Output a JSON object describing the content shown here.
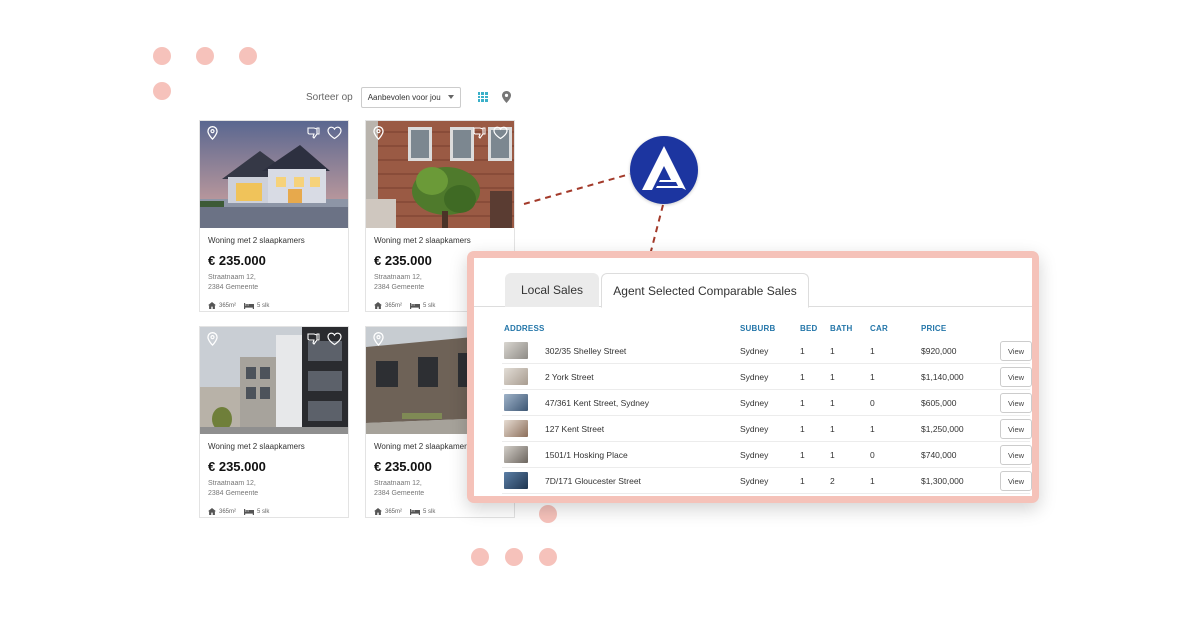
{
  "sort": {
    "label": "Sorteer op",
    "selected": "Aanbevolen voor jou"
  },
  "view_icons": [
    "grid-icon",
    "map-pin-icon"
  ],
  "listings": [
    {
      "title": "Woning met 2 slaapkamers",
      "price": "€ 235.000",
      "street": "Straatnaam 12,",
      "city": "2384 Gemeente",
      "area": "365m²",
      "beds": "5 slk"
    },
    {
      "title": "Woning met 2 slaapkamers",
      "price": "€ 235.000",
      "street": "Straatnaam 12,",
      "city": "2384 Gemeente",
      "area": "365m²",
      "beds": "5 slk"
    },
    {
      "title": "Woning met 2 slaapkamers",
      "price": "€ 235.000",
      "street": "Straatnaam 12,",
      "city": "2384 Gemeente",
      "area": "365m²",
      "beds": "5 slk"
    },
    {
      "title": "Woning met 2 slaapkamers",
      "price": "€ 235.000",
      "street": "Straatnaam 12,",
      "city": "2384 Gemeente",
      "area": "365m²",
      "beds": "5 slk"
    }
  ],
  "comparables": {
    "tabs": [
      {
        "label": "Local Sales",
        "active": false
      },
      {
        "label": "Agent Selected Comparable Sales",
        "active": true
      }
    ],
    "columns": {
      "address": "ADDRESS",
      "suburb": "SUBURB",
      "bed": "BED",
      "bath": "BATH",
      "car": "CAR",
      "price": "PRICE"
    },
    "rows": [
      {
        "address": "302/35 Shelley Street",
        "suburb": "Sydney",
        "bed": "1",
        "bath": "1",
        "car": "1",
        "price": "$920,000",
        "action": "View"
      },
      {
        "address": "2 York Street",
        "suburb": "Sydney",
        "bed": "1",
        "bath": "1",
        "car": "1",
        "price": "$1,140,000",
        "action": "View"
      },
      {
        "address": "47/361 Kent Street, Sydney",
        "suburb": "Sydney",
        "bed": "1",
        "bath": "1",
        "car": "0",
        "price": "$605,000",
        "action": "View"
      },
      {
        "address": "127 Kent Street",
        "suburb": "Sydney",
        "bed": "1",
        "bath": "1",
        "car": "1",
        "price": "$1,250,000",
        "action": "View"
      },
      {
        "address": "1501/1 Hosking Place",
        "suburb": "Sydney",
        "bed": "1",
        "bath": "1",
        "car": "0",
        "price": "$740,000",
        "action": "View"
      },
      {
        "address": "7D/171 Gloucester Street",
        "suburb": "Sydney",
        "bed": "1",
        "bath": "2",
        "car": "1",
        "price": "$1,300,000",
        "action": "View"
      }
    ]
  },
  "colors": {
    "accent_dots": "#f6c2bb",
    "panel_border": "#f5c2b9",
    "header_blue": "#2476a9",
    "logo_blue": "#1c35a0",
    "connector": "#a33a2a",
    "grid_icon": "#3bb0c9"
  }
}
